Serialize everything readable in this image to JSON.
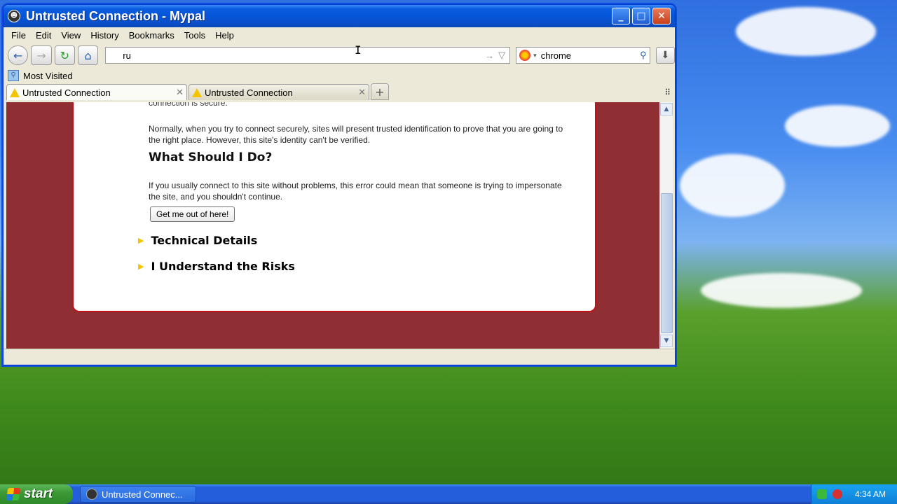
{
  "window": {
    "title": "Untrusted Connection - Mypal",
    "buttons": {
      "minimize": "_",
      "maximize": "□",
      "close": "✕"
    }
  },
  "menu": [
    "File",
    "Edit",
    "View",
    "History",
    "Bookmarks",
    "Tools",
    "Help"
  ],
  "navbar": {
    "url": "ru",
    "search_text": "chrome"
  },
  "bookmarks": {
    "most_visited": "Most Visited"
  },
  "tabs": [
    {
      "label": "Untrusted Connection",
      "active": true
    },
    {
      "label": "Untrusted Connection",
      "active": false
    }
  ],
  "error_page": {
    "fragment": "connection is secure.",
    "paragraph1": "Normally, when you try to connect securely, sites will present trusted identification to prove that you are going to the right place. However, this site's identity can't be verified.",
    "heading": "What Should I Do?",
    "paragraph2": "If you usually connect to this site without problems, this error could mean that someone is trying to impersonate the site, and you shouldn't continue.",
    "button": "Get me out of here!",
    "expander1": "Technical Details",
    "expander2": "I Understand the Risks"
  },
  "taskbar": {
    "start": "start",
    "task_item": "Untrusted Connec...",
    "clock": "4:34 AM"
  },
  "colors": {
    "page_background": "#8f2e33",
    "error_border": "#c1121a",
    "warning_yellow": "#f5c400",
    "titlebar_blue": "#0655d8"
  }
}
